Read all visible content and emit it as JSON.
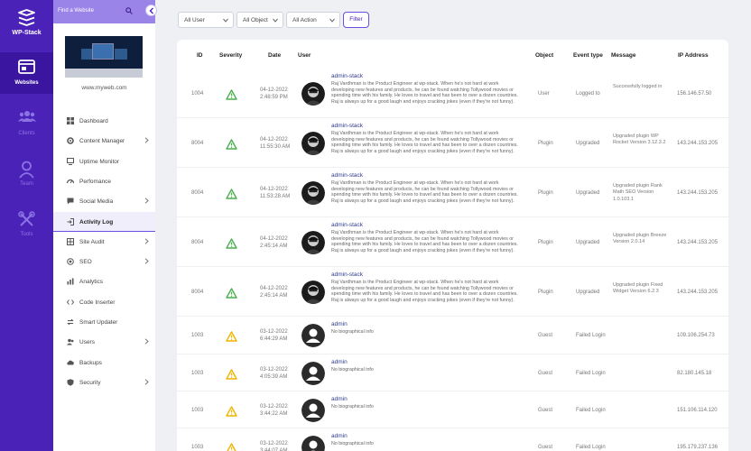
{
  "app": {
    "brand": "WP-Stack"
  },
  "rail": [
    {
      "id": "websites",
      "label": "Websites",
      "active": true
    },
    {
      "id": "clients",
      "label": "Clients",
      "active": false
    },
    {
      "id": "team",
      "label": "Team",
      "active": false
    },
    {
      "id": "tools",
      "label": "Tools",
      "active": false
    }
  ],
  "panel": {
    "find_placeholder": "Find a Website",
    "site_url": "www.myweb.com",
    "nav": [
      {
        "label": "Dashboard",
        "icon": "dashboard-icon",
        "chevron": false,
        "active": false
      },
      {
        "label": "Content Manager",
        "icon": "gear-icon",
        "chevron": true,
        "active": false
      },
      {
        "label": "Uptime Monitor",
        "icon": "monitor-icon",
        "chevron": false,
        "active": false
      },
      {
        "label": "Perfomance",
        "icon": "gauge-icon",
        "chevron": false,
        "active": false
      },
      {
        "label": "Social Media",
        "icon": "chat-icon",
        "chevron": true,
        "active": false
      },
      {
        "label": "Activity Log",
        "icon": "login-icon",
        "chevron": false,
        "active": true
      },
      {
        "label": "Site Audit",
        "icon": "grid-icon",
        "chevron": true,
        "active": false
      },
      {
        "label": "SEO",
        "icon": "target-icon",
        "chevron": true,
        "active": false
      },
      {
        "label": "Analytics",
        "icon": "chart-icon",
        "chevron": false,
        "active": false
      },
      {
        "label": "Code Inserter",
        "icon": "code-icon",
        "chevron": false,
        "active": false
      },
      {
        "label": "Smart Updater",
        "icon": "refresh-icon",
        "chevron": false,
        "active": false
      },
      {
        "label": "Users",
        "icon": "users-icon",
        "chevron": true,
        "active": false
      },
      {
        "label": "Backups",
        "icon": "cloud-icon",
        "chevron": false,
        "active": false
      },
      {
        "label": "Security",
        "icon": "shield-icon",
        "chevron": true,
        "active": false
      }
    ]
  },
  "filters": {
    "user": "All User",
    "object": "All Object",
    "action": "All Action",
    "button": "Filter"
  },
  "table": {
    "headers": [
      "ID",
      "Severity",
      "Date",
      "User",
      "Object",
      "Event type",
      "Message",
      "IP Address"
    ],
    "rows": [
      {
        "id": "1004",
        "severity": "success",
        "date": "04-12-2022",
        "time": "2:48:59 PM",
        "user": "admin-stack",
        "bio": "Raj Vardhman is the Product Engineer at wp-stack. When he's not hard at work developing new features and products, he can be found watching Tollywood movies or spending time with his family. He loves to travel and has been to over a dozen countries. Raj is always up for a good laugh and enjoys cracking jokes (even if they're not funny).",
        "photo": true,
        "object": "User",
        "event": "Logged to",
        "message": "Successfully logged in",
        "ip": "156.146.57.50"
      },
      {
        "id": "8004",
        "severity": "success",
        "date": "04-12-2022",
        "time": "11:55:30 AM",
        "user": "admin-stack",
        "bio": "Raj Vardhman is the Product Engineer at wp-stack. When he's not hard at work developing new features and products, he can be found watching Tollywood movies or spending time with his family. He loves to travel and has been to over a dozen countries. Raj is always up for a good laugh and enjoys cracking jokes (even if they're not funny).",
        "photo": true,
        "object": "Plugin",
        "event": "Upgraded",
        "message": "Upgraded plugin WP Rocket Version 3.12.3.2",
        "ip": "143.244.153.205"
      },
      {
        "id": "8004",
        "severity": "success",
        "date": "04-12-2022",
        "time": "11:53:28 AM",
        "user": "admin-stack",
        "bio": "Raj Vardhman is the Product Engineer at wp-stack. When he's not hard at work developing new features and products, he can be found watching Tollywood movies or spending time with his family. He loves to travel and has been to over a dozen countries. Raj is always up for a good laugh and enjoys cracking jokes (even if they're not funny).",
        "photo": true,
        "object": "Plugin",
        "event": "Upgraded",
        "message": "Upgraded plugin Rank Math SEO Version 1.0.103.1",
        "ip": "143.244.153.205"
      },
      {
        "id": "8004",
        "severity": "success",
        "date": "04-12-2022",
        "time": "2:45:14 AM",
        "user": "admin-stack",
        "bio": "Raj Vardhman is the Product Engineer at wp-stack. When he's not hard at work developing new features and products, he can be found watching Tollywood movies or spending time with his family. He loves to travel and has been to over a dozen countries. Raj is always up for a good laugh and enjoys cracking jokes (even if they're not funny).",
        "photo": true,
        "object": "Plugin",
        "event": "Upgraded",
        "message": "Upgraded plugin Breeze Version 2.0.14",
        "ip": "143.244.153.205"
      },
      {
        "id": "8004",
        "severity": "success",
        "date": "04-12-2022",
        "time": "2:45:14 AM",
        "user": "admin-stack",
        "bio": "Raj Vardhman is the Product Engineer at wp-stack. When he's not hard at work developing new features and products, he can be found watching Tollywood movies or spending time with his family. He loves to travel and has been to over a dozen countries. Raj is always up for a good laugh and enjoys cracking jokes (even if they're not funny).",
        "photo": true,
        "object": "Plugin",
        "event": "Upgraded",
        "message": "Upgraded plugin Fixed Widget Version 6.2.3",
        "ip": "143.244.153.205"
      },
      {
        "id": "1003",
        "severity": "warning",
        "date": "03-12-2022",
        "time": "6:44:29 AM",
        "user": "admin",
        "bio": "No biographical info",
        "photo": false,
        "object": "Guest",
        "event": "Failed Login",
        "message": "",
        "ip": "109.106.254.73"
      },
      {
        "id": "1003",
        "severity": "warning",
        "date": "03-12-2022",
        "time": "4:05:39 AM",
        "user": "admin",
        "bio": "No biographical info",
        "photo": false,
        "object": "Guest",
        "event": "Failed Login",
        "message": "",
        "ip": "82.180.145.18"
      },
      {
        "id": "1003",
        "severity": "warning",
        "date": "03-12-2022",
        "time": "3:44:22 AM",
        "user": "admin",
        "bio": "No biographical info",
        "photo": false,
        "object": "Guest",
        "event": "Failed Login",
        "message": "",
        "ip": "151.106.114.120"
      },
      {
        "id": "1003",
        "severity": "warning",
        "date": "03-12-2022",
        "time": "3:44:07 AM",
        "user": "admin",
        "bio": "No biographical info",
        "photo": false,
        "object": "Guest",
        "event": "Failed Login",
        "message": "",
        "ip": "195.179.237.136"
      }
    ]
  },
  "colors": {
    "primary": "#4a22b8",
    "success": "#4caf50",
    "warning": "#f0b400"
  }
}
